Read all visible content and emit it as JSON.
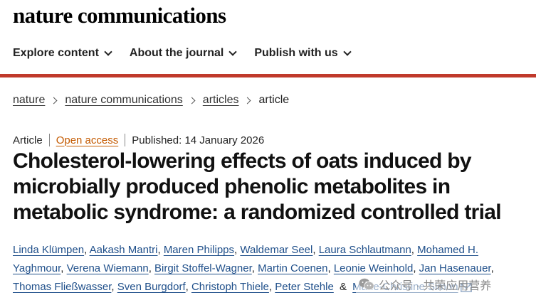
{
  "masthead": {
    "logo_text": "nature communications"
  },
  "nav": {
    "items": [
      {
        "label": "Explore content"
      },
      {
        "label": "About the journal"
      },
      {
        "label": "Publish with us"
      }
    ]
  },
  "breadcrumb": {
    "items": [
      "nature",
      "nature communications",
      "articles"
    ],
    "current": "article"
  },
  "article": {
    "type": "Article",
    "access": "Open access",
    "published": "Published: 14 January 2026",
    "title": "Cholesterol-lowering effects of oats induced by microbially produced phenolic metabolites in metabolic syndrome: a randomized controlled trial"
  },
  "authors": [
    "Linda Klümpen",
    "Aakash Mantri",
    "Maren Philipps",
    "Waldemar Seel",
    "Laura Schlautmann",
    "Mohamed H. Yaghmour",
    "Verena Wiemann",
    "Birgit Stoffel-Wagner",
    "Martin Coenen",
    "Leonie Weinhold",
    "Jan Hasenauer",
    "Thomas Fließwasser",
    "Sven Burgdorf",
    "Christoph Thiele",
    "Peter Stehle",
    "Marie-Christine Simon"
  ],
  "authors_ampersand": "&",
  "watermark": {
    "text": "公众号 · 共荣应用营养",
    "icon": "wechat-icon"
  },
  "colors": {
    "accent_rule": "#c0392b",
    "open_access": "#c45a00",
    "author_link": "#1f4f8a"
  }
}
